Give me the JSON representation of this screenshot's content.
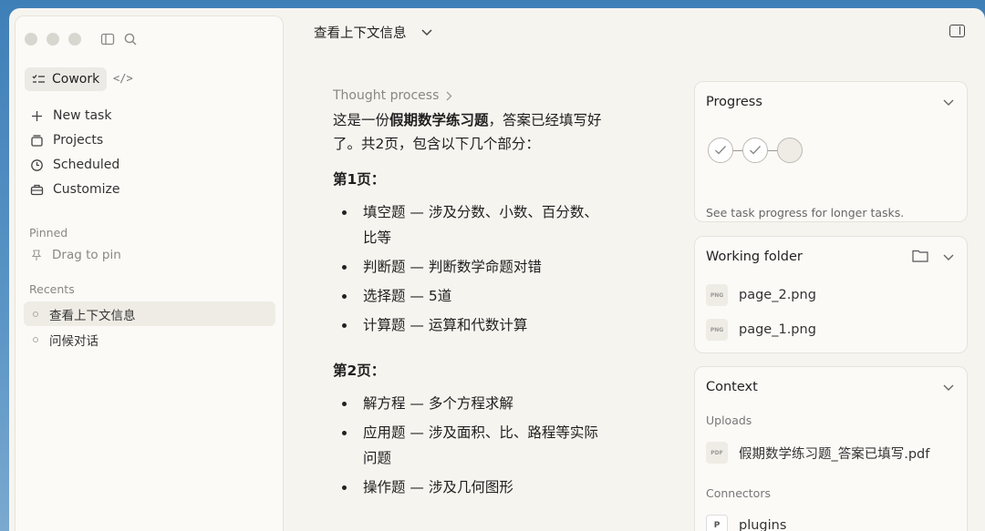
{
  "header": {
    "title": "查看上下文信息"
  },
  "sidebar": {
    "app_label": "Cowork",
    "nav": [
      {
        "label": "New task",
        "icon": "plus-icon"
      },
      {
        "label": "Projects",
        "icon": "projects-icon"
      },
      {
        "label": "Scheduled",
        "icon": "clock-icon"
      },
      {
        "label": "Customize",
        "icon": "briefcase-icon"
      }
    ],
    "pinned_label": "Pinned",
    "pin_hint": "Drag to pin",
    "recents_label": "Recents",
    "recents": [
      {
        "label": "查看上下文信息",
        "active": true
      },
      {
        "label": "问候对话",
        "active": false
      }
    ]
  },
  "main": {
    "thought": "Thought process",
    "intro_pre": "这是一份",
    "intro_bold": "假期数学练习题",
    "intro_post": "，答案已经填写好了。共2页，包含以下几个部分：",
    "page1_head": "第1页：",
    "page1_items": [
      "填空题 — 涉及分数、小数、百分数、比等",
      "判断题 — 判断数学命题对错",
      "选择题 — 5道",
      "计算题 — 运算和代数计算"
    ],
    "page2_head": "第2页：",
    "page2_items": [
      "解方程 — 多个方程求解",
      "应用题 — 涉及面积、比、路程等实际问题",
      "操作题 — 涉及几何图形"
    ]
  },
  "progress": {
    "title": "Progress",
    "note": "See task progress for longer tasks."
  },
  "working_folder": {
    "title": "Working folder",
    "files": [
      "page_2.png",
      "page_1.png"
    ],
    "file_badge": "PNG"
  },
  "context": {
    "title": "Context",
    "uploads_label": "Uploads",
    "upload_file": "假期数学练习题_答案已填写.pdf",
    "upload_badge": "PDF",
    "connectors_label": "Connectors",
    "connector": "plugins",
    "connector_badge": "P"
  }
}
